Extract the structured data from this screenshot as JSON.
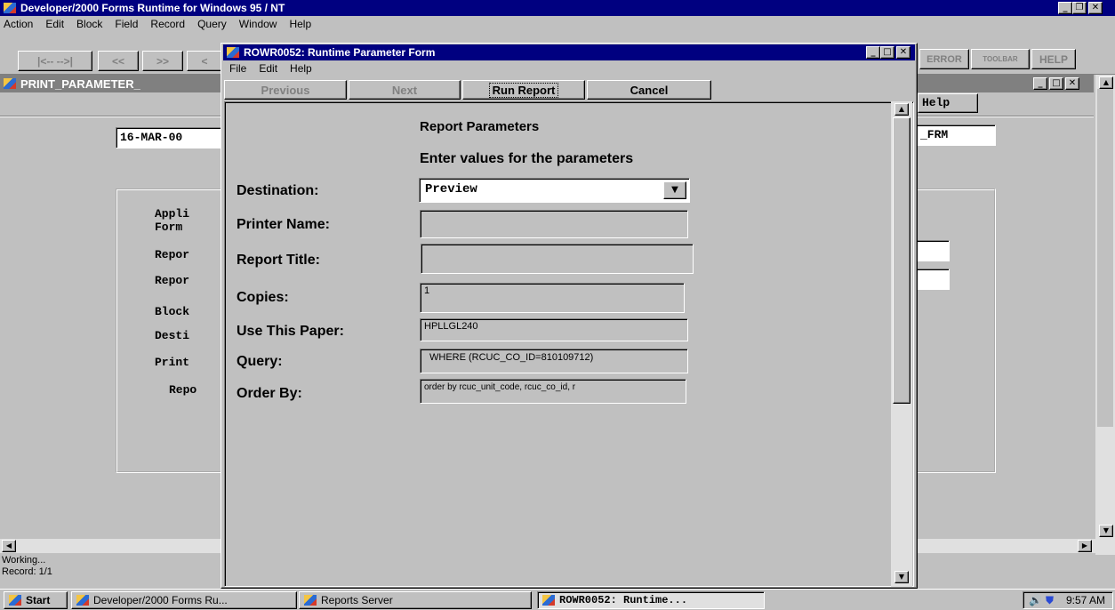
{
  "app": {
    "title": "Developer/2000 Forms Runtime for Windows 95 / NT",
    "menu": [
      "Action",
      "Edit",
      "Block",
      "Field",
      "Record",
      "Query",
      "Window",
      "Help"
    ],
    "toolbar_left": [
      "|<-- -->|",
      "<<",
      ">>",
      "<"
    ],
    "toolbar_right": [
      "ERROR",
      "TOOLBAR",
      "HELP"
    ]
  },
  "bg_form": {
    "title": "PRINT_PARAMETER_",
    "help_button": "Help",
    "date_value": "16-MAR-00",
    "right_field": "_FRM",
    "labels": [
      "Appli",
      "Form",
      "Repor",
      "Repor",
      "Block",
      "Desti",
      "Print",
      "Repo"
    ]
  },
  "dialog": {
    "title": "ROWR0052: Runtime Parameter Form",
    "menu": [
      "File",
      "Edit",
      "Help"
    ],
    "buttons": {
      "previous": "Previous",
      "next": "Next",
      "run": "Run Report",
      "cancel": "Cancel"
    },
    "heading": "Report Parameters",
    "subheading": "Enter values for the parameters",
    "fields": {
      "destination": {
        "label": "Destination:",
        "value": "Preview"
      },
      "printer": {
        "label": "Printer Name:",
        "value": ""
      },
      "title": {
        "label": "Report Title:",
        "value": ""
      },
      "copies": {
        "label": "Copies:",
        "value": "1"
      },
      "paper": {
        "label": "Use This Paper:",
        "value": "HPLLGL240"
      },
      "query": {
        "label": "Query:",
        "value": "WHERE (RCUC_CO_ID=810109712)"
      },
      "order": {
        "label": "Order By:",
        "value": "order by rcuc_unit_code, rcuc_co_id, r"
      }
    }
  },
  "status": {
    "line1": "Working...",
    "line2": "Record: 1/1"
  },
  "taskbar": {
    "start": "Start",
    "tasks": [
      "Developer/2000 Forms Ru...",
      "Reports Server",
      "ROWR0052: Runtime..."
    ],
    "time": "9:57 AM"
  }
}
